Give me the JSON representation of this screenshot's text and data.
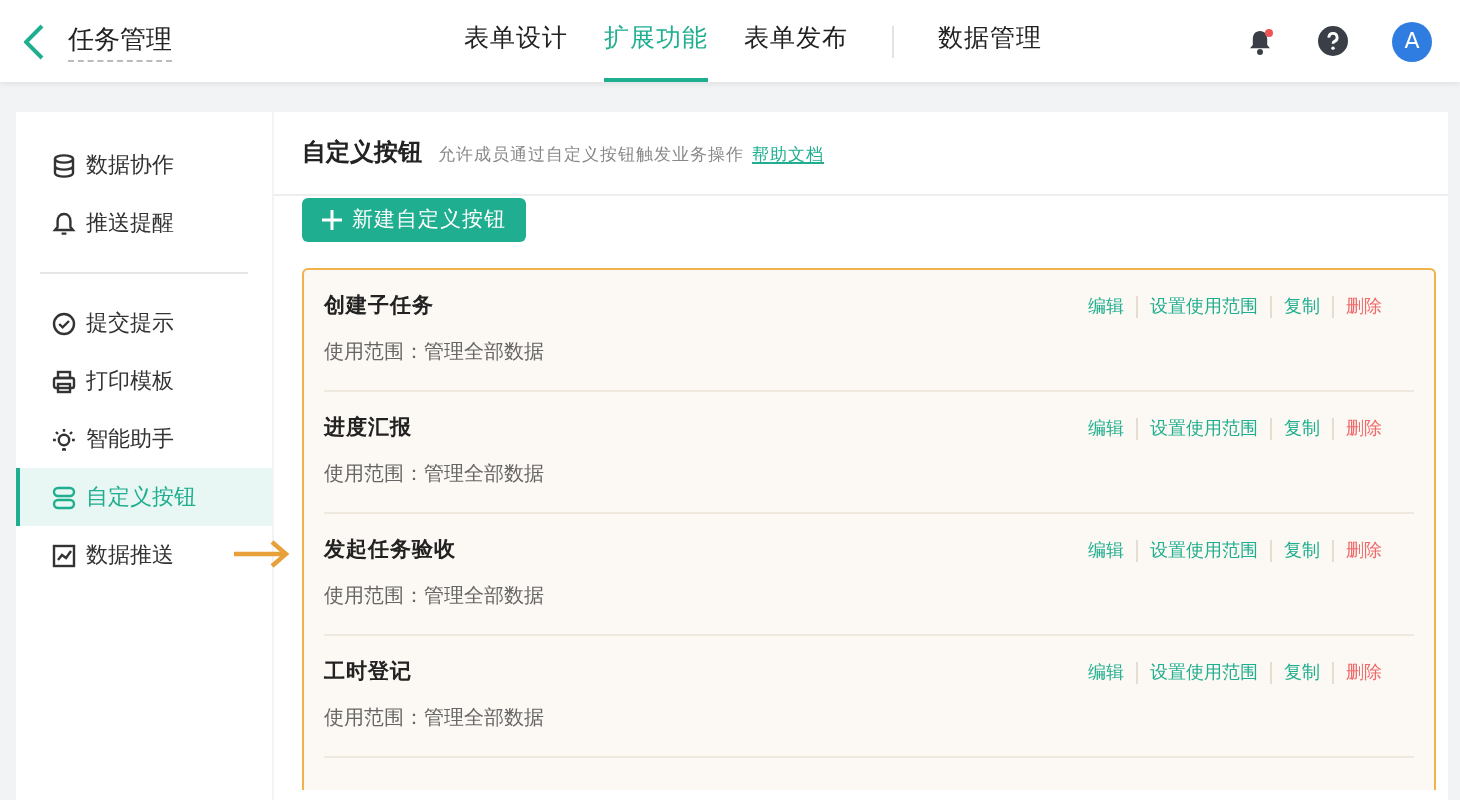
{
  "header": {
    "title": "任务管理",
    "has_notification": true,
    "avatar": "A",
    "tab_groups": [
      [
        {
          "label": "表单设计",
          "selected": false
        },
        {
          "label": "扩展功能",
          "selected": true
        },
        {
          "label": "表单发布",
          "selected": false
        }
      ],
      [
        {
          "label": "数据管理",
          "selected": false
        }
      ]
    ]
  },
  "sidebar": {
    "groups": [
      [
        {
          "label": "数据协作",
          "selected": false
        },
        {
          "label": "推送提醒",
          "selected": false
        }
      ],
      [
        {
          "label": "提交提示",
          "selected": false
        },
        {
          "label": "打印模板",
          "selected": false
        },
        {
          "label": "智能助手",
          "selected": false
        },
        {
          "label": "自定义按钮",
          "selected": true
        },
        {
          "label": "数据推送",
          "selected": false
        }
      ]
    ]
  },
  "panel": {
    "title": "自定义按钮",
    "description": "允许成员通过自定义按钮触发业务操作",
    "help_link": "帮助文档",
    "new_button": "新建自定义按钮",
    "rows": [
      {
        "name": "创建子任务",
        "scope": "使用范围：管理全部数据",
        "pointed": false,
        "actions": [
          {
            "label": "编辑",
            "kind": "normal"
          },
          {
            "label": "设置使用范围",
            "kind": "normal"
          },
          {
            "label": "复制",
            "kind": "normal"
          },
          {
            "label": "删除",
            "kind": "danger"
          }
        ]
      },
      {
        "name": "进度汇报",
        "scope": "使用范围：管理全部数据",
        "pointed": false,
        "actions": [
          {
            "label": "编辑",
            "kind": "normal"
          },
          {
            "label": "设置使用范围",
            "kind": "normal"
          },
          {
            "label": "复制",
            "kind": "normal"
          },
          {
            "label": "删除",
            "kind": "danger"
          }
        ]
      },
      {
        "name": "发起任务验收",
        "scope": "使用范围：管理全部数据",
        "pointed": true,
        "actions": [
          {
            "label": "编辑",
            "kind": "normal"
          },
          {
            "label": "设置使用范围",
            "kind": "normal"
          },
          {
            "label": "复制",
            "kind": "normal"
          },
          {
            "label": "删除",
            "kind": "danger"
          }
        ]
      },
      {
        "name": "工时登记",
        "scope": "使用范围：管理全部数据",
        "pointed": false,
        "actions": [
          {
            "label": "编辑",
            "kind": "normal"
          },
          {
            "label": "设置使用范围",
            "kind": "normal"
          },
          {
            "label": "复制",
            "kind": "normal"
          },
          {
            "label": "删除",
            "kind": "danger"
          }
        ]
      }
    ]
  }
}
